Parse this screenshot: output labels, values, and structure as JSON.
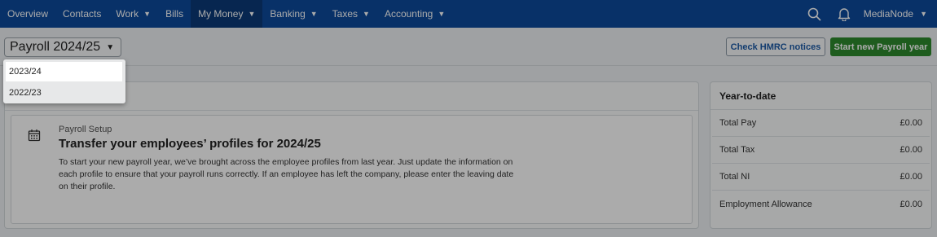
{
  "nav": {
    "items": [
      {
        "label": "Overview"
      },
      {
        "label": "Contacts"
      },
      {
        "label": "Work"
      },
      {
        "label": "Bills"
      },
      {
        "label": "My Money"
      },
      {
        "label": "Banking"
      },
      {
        "label": "Taxes"
      },
      {
        "label": "Accounting"
      }
    ],
    "org_name": "MediaNode",
    "icons": [
      "search-icon",
      "bell-icon",
      "chevron-down-icon"
    ]
  },
  "header": {
    "year_select": "Payroll 2024/25",
    "check_hmrc": "Check HMRC notices",
    "start_new_year": "Start new Payroll year"
  },
  "year_menu": {
    "options": [
      "2023/24",
      "2022/23"
    ]
  },
  "setup": {
    "kicker": "Payroll Setup",
    "title": "Transfer your employees’ profiles for 2024/25",
    "body": "To start your new payroll year, we’ve brought across the employee profiles from last year. Just update the information on each profile to ensure that your payroll runs correctly. If an employee has left the company, please enter the leaving date on their profile."
  },
  "ytd": {
    "title": "Year-to-date",
    "rows": [
      {
        "label": "Total Pay",
        "value": "£0.00"
      },
      {
        "label": "Total Tax",
        "value": "£0.00"
      },
      {
        "label": "Total NI",
        "value": "£0.00"
      },
      {
        "label": "Employment Allowance",
        "value": "£0.00"
      }
    ]
  },
  "colors": {
    "nav_bg": "#0d4a9c",
    "nav_active": "#0b3a78",
    "primary_button": "#2e8a2e",
    "link": "#1c5aa6"
  }
}
